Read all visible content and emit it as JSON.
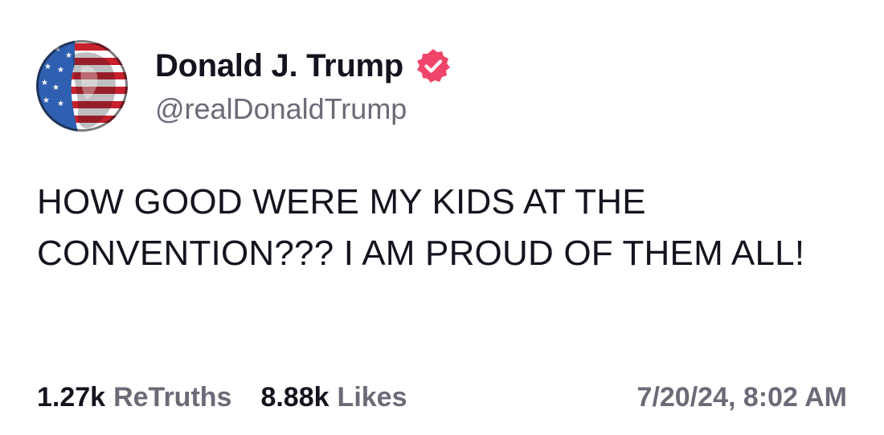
{
  "post": {
    "author": {
      "display_name": "Donald J. Trump",
      "handle": "@realDonaldTrump",
      "verified": true,
      "verified_badge_color": "#f0456a",
      "avatar_icon": "flag-portrait-avatar"
    },
    "body_text": "HOW GOOD WERE MY KIDS AT THE CONVENTION??? I AM PROUD OF THEM ALL!",
    "stats": {
      "retruths_count": "1.27k",
      "retruths_label": "ReTruths",
      "likes_count": "8.88k",
      "likes_label": "Likes"
    },
    "timestamp": "7/20/24, 8:02 AM"
  },
  "colors": {
    "text_primary": "#14141f",
    "text_secondary": "#6b6b78",
    "background": "#ffffff"
  }
}
